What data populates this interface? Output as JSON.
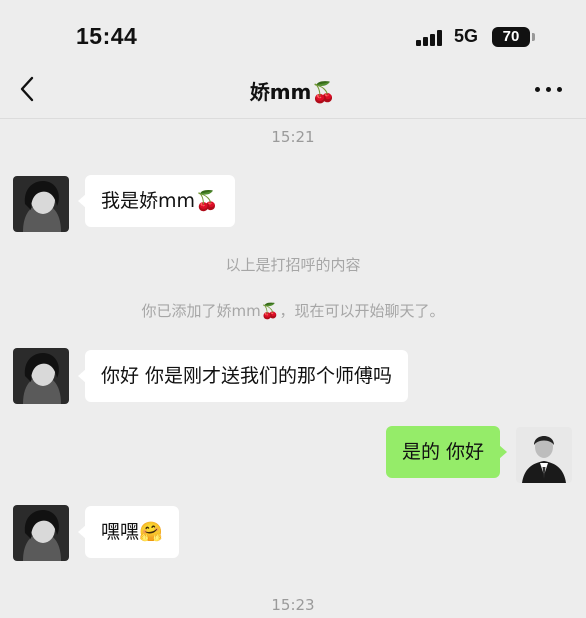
{
  "status_bar": {
    "time": "15:44",
    "network": "5G",
    "battery": "70"
  },
  "nav": {
    "title": "娇mm🍒",
    "back_icon": "chevron-left-icon",
    "more_icon": "more-dots-icon"
  },
  "messages": {
    "ts1": "15:21",
    "msg1": "我是娇mm🍒",
    "sys1": "以上是打招呼的内容",
    "sys2": "你已添加了娇mm🍒，现在可以开始聊天了。",
    "msg2": "你好 你是刚才送我们的那个师傅吗",
    "msg3_me": "是的 你好",
    "msg4": "嘿嘿🤗",
    "ts2": "15:23"
  },
  "colors": {
    "background": "#ededed",
    "bubble_other": "#ffffff",
    "bubble_me": "#95ec69",
    "timestamp": "#9a9a9a"
  }
}
